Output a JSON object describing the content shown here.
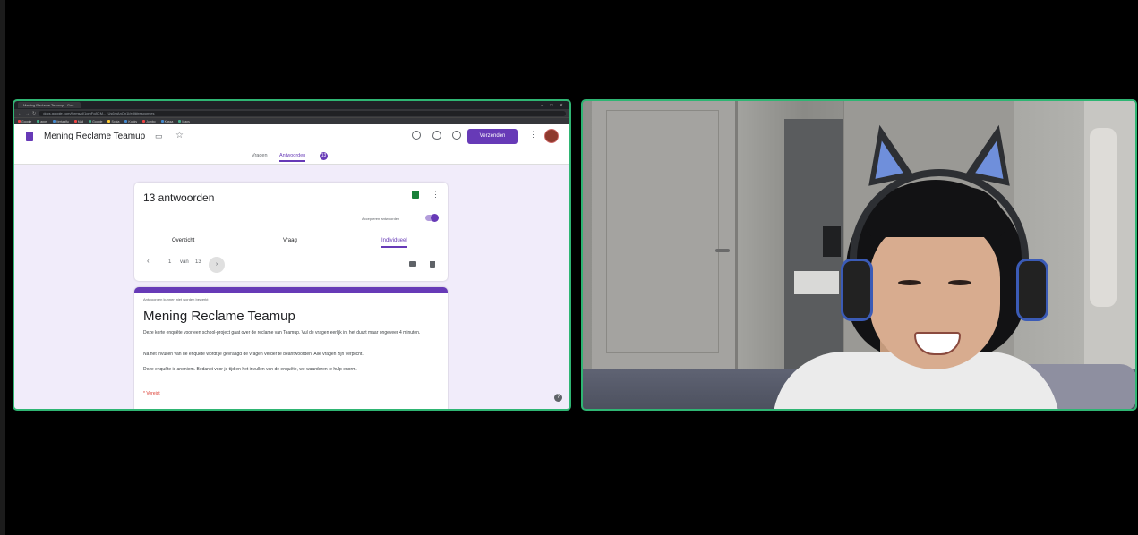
{
  "browser": {
    "tab_title": "Mening Reclame Teamup - Goo...",
    "window_controls": "– □ ✕",
    "url": "docs.google.com/forms/d/1qmFq8CM..._Us6mAnQn1l/edit#responses",
    "bookmarks": [
      "Google",
      "apps",
      "Vertaalfu",
      "Mail",
      "Google",
      "Sonja",
      "Kooky",
      "Jumbo",
      "Kassa",
      "Maps"
    ]
  },
  "forms": {
    "title": "Mening Reclame Teamup",
    "send_label": "Verzenden",
    "tabs": [
      {
        "label": "Vragen"
      },
      {
        "label": "Antwoorden"
      }
    ],
    "response_count_badge": "13",
    "responses_title": "13 antwoorden",
    "accept_label": "Accepteren antwoorden",
    "subtabs": [
      {
        "label": "Overzicht"
      },
      {
        "label": "Vraag"
      },
      {
        "label": "Individueel"
      }
    ],
    "pager": {
      "prev": "‹",
      "current": "1",
      "of": "van",
      "total": "13",
      "next": "›"
    }
  },
  "form_preview": {
    "note": "Antwoorden kunnen niet worden bewerkt",
    "heading": "Mening Reclame Teamup",
    "desc1": "Deze korte enquête voor een school-project gaat over de reclame van Teamup. Vul de vragen eerlijk in, het duurt maar ongeveer 4 minuten.",
    "desc2": "Na het invullen van de enquête wordt je gevraagd de vragen verder te beantwoorden. Alle vragen zijn verplicht.",
    "desc3": "Deze enquête is anoniem. Bedankt voor je tijd en het invullen van de enquête, we waarderen je hulp enorm.",
    "required": "* Vereist"
  },
  "colors": {
    "accent": "#673ab7",
    "tile_border": "#2fb573",
    "background": "#000000"
  },
  "icons": [
    "doc-icon",
    "folder-icon",
    "star-icon",
    "palette-icon",
    "eye-icon",
    "settings-icon",
    "more-icon",
    "sheets-icon",
    "print-icon",
    "trash-icon",
    "help-icon",
    "chevron-left-icon",
    "chevron-right-icon"
  ]
}
